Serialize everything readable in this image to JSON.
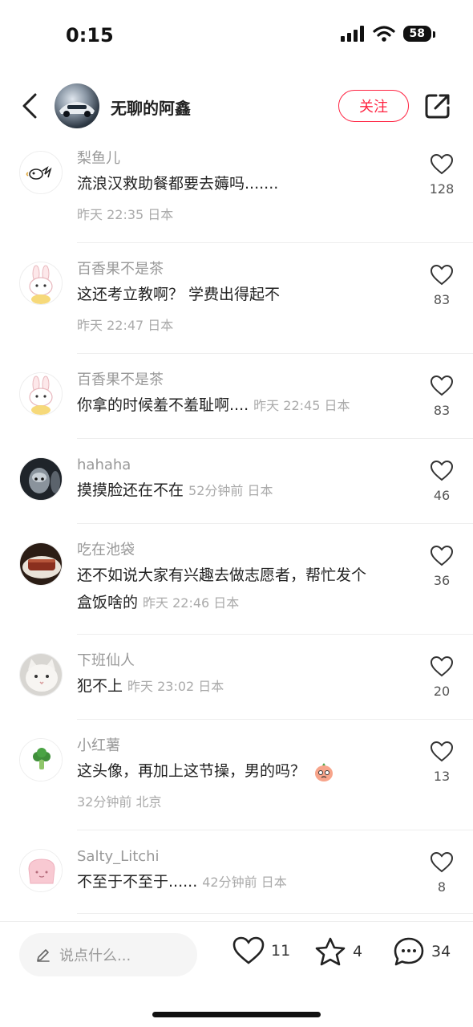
{
  "status_bar": {
    "time": "0:15",
    "battery": "58"
  },
  "header": {
    "author_name": "无聊的阿鑫",
    "follow_label": "关注"
  },
  "comments": [
    {
      "name": "梨鱼儿",
      "text": "流浪汉救助餐都要去薅吗.......",
      "meta": "昨天 22:35 日本",
      "likes": "128",
      "avatar": "logo-avatar"
    },
    {
      "name": "百香果不是茶",
      "text": "这还考立教啊？ 学费出得起不",
      "meta": "昨天 22:47 日本",
      "likes": "83",
      "avatar": "bunny-avatar"
    },
    {
      "name": "百香果不是茶",
      "text": "你拿的时候羞不羞耻啊....",
      "meta": "昨天 22:45 日本",
      "likes": "83",
      "avatar": "bunny-avatar"
    },
    {
      "name": "hahaha",
      "text": "摸摸脸还在不在",
      "meta": "52分钟前 日本",
      "likes": "46",
      "avatar": "dark-avatar"
    },
    {
      "name": "吃在池袋",
      "text": "还不如说大家有兴趣去做志愿者，帮忙发个",
      "text2": "盒饭啥的",
      "meta": "昨天 22:46 日本",
      "likes": "36",
      "avatar": "food-avatar"
    },
    {
      "name": "下班仙人",
      "text": "犯不上",
      "meta": "昨天 23:02 日本",
      "likes": "20",
      "avatar": "cat-avatar"
    },
    {
      "name": "小红薯",
      "text": "这头像，再加上这节操，男的吗？",
      "meta": "32分钟前 北京",
      "likes": "13",
      "avatar": "broccoli-avatar"
    },
    {
      "name": "Salty_Litchi",
      "text": "不至于不至于......",
      "meta": "42分钟前 日本",
      "likes": "8",
      "avatar": "toast-avatar"
    }
  ],
  "bottom_bar": {
    "input_placeholder": "说点什么...",
    "like_count": "11",
    "star_count": "4",
    "comment_count": "34"
  },
  "colors": {
    "accent": "#ff2442"
  }
}
